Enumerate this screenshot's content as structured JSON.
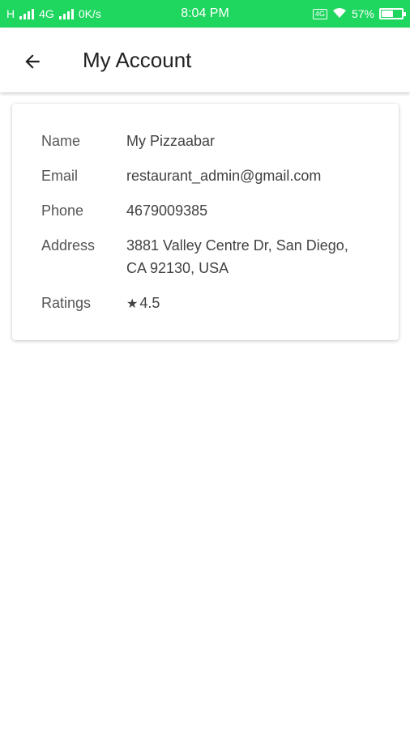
{
  "status_bar": {
    "carrier_left": "H",
    "network_type": "4G",
    "speed": "0K/s",
    "time": "8:04 PM",
    "battery_percent": "57%",
    "battery_level": 0.57,
    "background_color": "#1fd65f"
  },
  "app_bar": {
    "back_icon": "arrow-left-icon",
    "title": "My Account"
  },
  "account": {
    "name_label": "Name",
    "name_value": "My Pizzaabar",
    "email_label": "Email",
    "email_value": "restaurant_admin@gmail.com",
    "phone_label": "Phone",
    "phone_value": "4679009385",
    "address_label": "Address",
    "address_value_line1": "3881 Valley Centre Dr, San Diego,",
    "address_value_line2": "CA 92130, USA",
    "ratings_label": "Ratings",
    "ratings_icon": "star-icon",
    "ratings_value": "4.5"
  }
}
